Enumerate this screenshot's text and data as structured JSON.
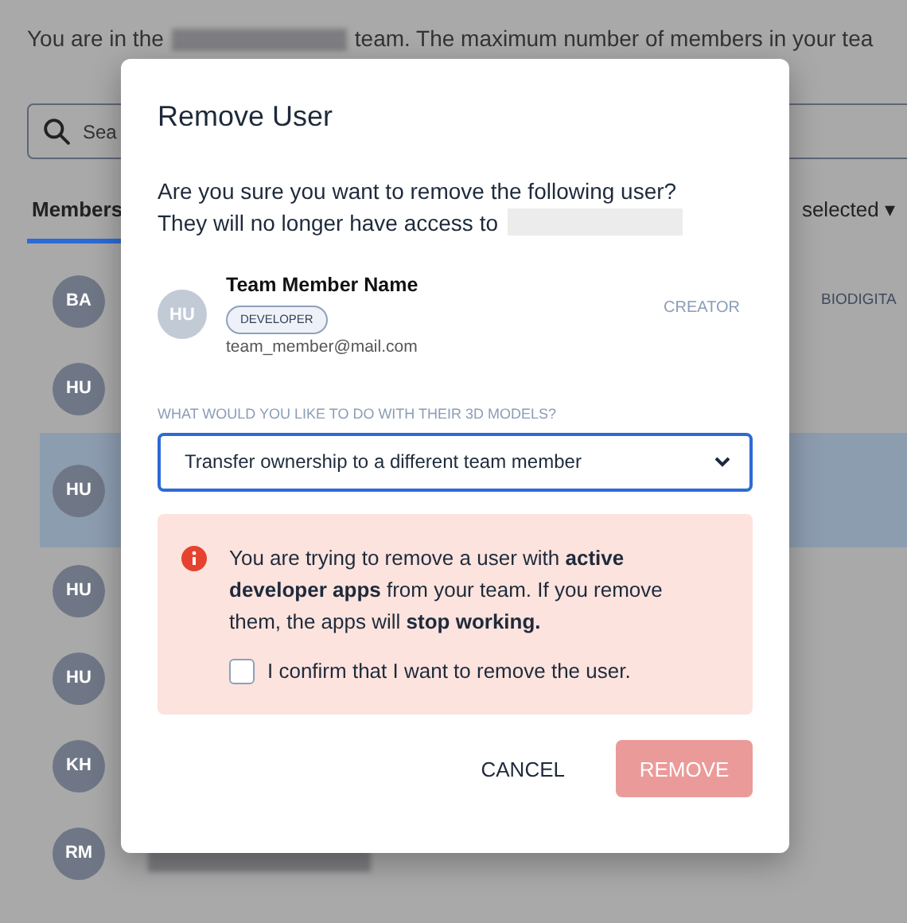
{
  "page": {
    "intro_before": "You are in the",
    "intro_after": "team. The maximum number of members in your tea",
    "search": {
      "placeholder": "Sea"
    },
    "tabs": [
      {
        "label": "Members",
        "selected": true
      }
    ],
    "filter": {
      "label": "selected",
      "caret": "▾"
    },
    "members": [
      {
        "initials": "BA",
        "selected": false,
        "org": "BIODIGITA"
      },
      {
        "initials": "HU",
        "selected": false
      },
      {
        "initials": "HU",
        "selected": true
      },
      {
        "initials": "HU",
        "selected": false
      },
      {
        "initials": "HU",
        "selected": false
      },
      {
        "initials": "KH",
        "selected": false
      },
      {
        "initials": "RM",
        "selected": false,
        "redacted_name": true
      }
    ]
  },
  "dialog": {
    "title": "Remove User",
    "message_lines": [
      "Are you sure you want to remove the following user?",
      "They will no longer have access to"
    ],
    "user": {
      "initials": "HU",
      "name": "Team Member Name",
      "badge": "DEVELOPER",
      "email": "team_member@mail.com",
      "role": "CREATOR"
    },
    "models_label": "WHAT WOULD YOU LIKE TO DO WITH THEIR 3D MODELS?",
    "models_value": "Transfer ownership to a different team member",
    "warning": "You are trying to remove a user with **active developer apps** from your team. If you remove them, the apps will **stop working.**",
    "confirm": {
      "label": "I confirm that I want to remove the user.",
      "checked": false
    },
    "buttons": [
      {
        "label": "CANCEL",
        "kind": "text",
        "disabled": false
      },
      {
        "label": "REMOVE",
        "kind": "danger",
        "disabled": true
      }
    ]
  }
}
